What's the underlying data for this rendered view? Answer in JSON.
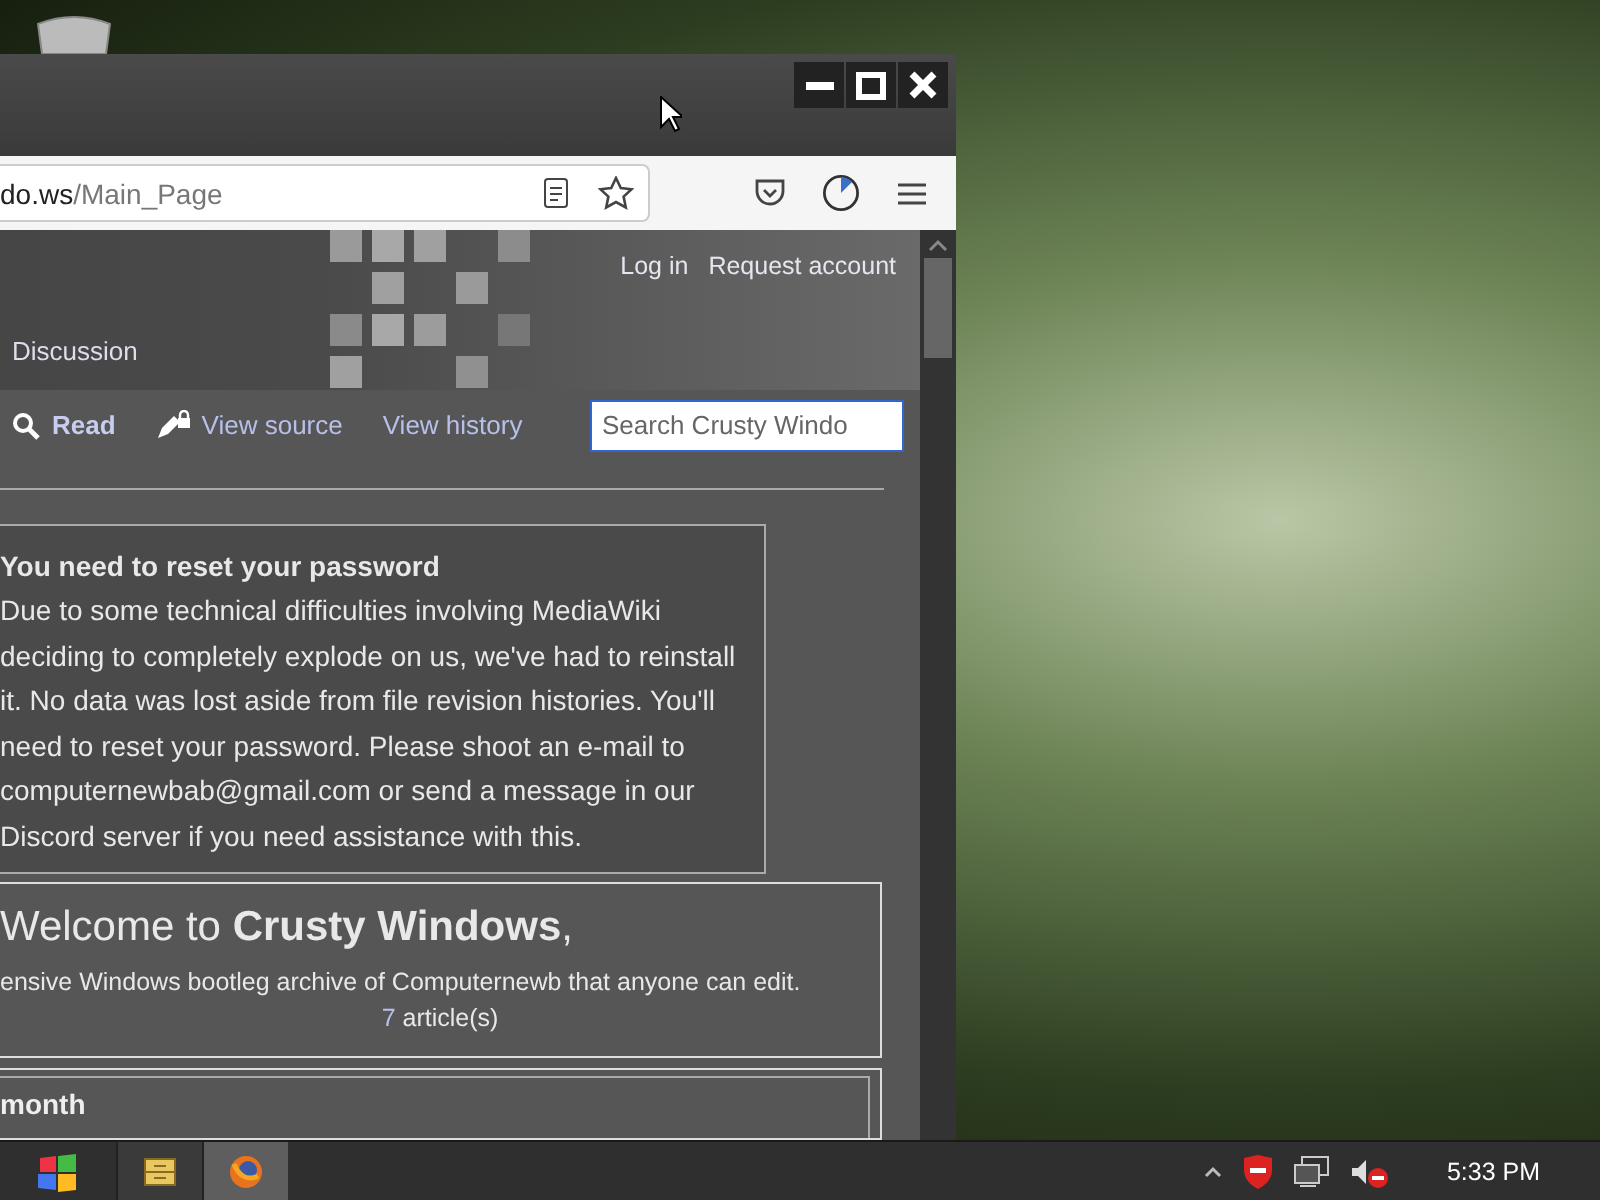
{
  "browser": {
    "url_host": "do.ws",
    "url_path": "/Main_Page"
  },
  "wiki": {
    "personal_links": [
      "Log in",
      "Request account"
    ],
    "namespace_tabs": [
      {
        "label": "Discussion",
        "selected": false
      }
    ],
    "views": [
      {
        "label": "Read",
        "kind": "search",
        "selected": true
      },
      {
        "label": "View source",
        "kind": "protected",
        "selected": false
      },
      {
        "label": "View history",
        "kind": "plain",
        "selected": false
      }
    ],
    "search": {
      "placeholder": "Search Crusty Windo"
    },
    "notice": {
      "title": "You need to reset your password",
      "body": "Due to some technical difficulties involving MediaWiki deciding to completely explode on us, we've had to reinstall it. No data was lost aside from file revision histories. You'll need to reset your password. Please shoot an e-mail to computernewbab@gmail.com or send a message in our Discord server if you need assistance with this."
    },
    "welcome": {
      "title": "Welcome to **Crusty Windows**,",
      "subtitle": "ensive Windows bootleg archive of Computernewb that anyone can edit.",
      "article_count": "7",
      "article_suffix": "article(s)"
    },
    "next_section": {
      "heading": "month"
    }
  },
  "taskbar": {
    "apps": [
      {
        "kind": "explorer",
        "selected": false
      },
      {
        "kind": "firefox",
        "selected": true
      }
    ],
    "clock": "5:33 PM"
  }
}
